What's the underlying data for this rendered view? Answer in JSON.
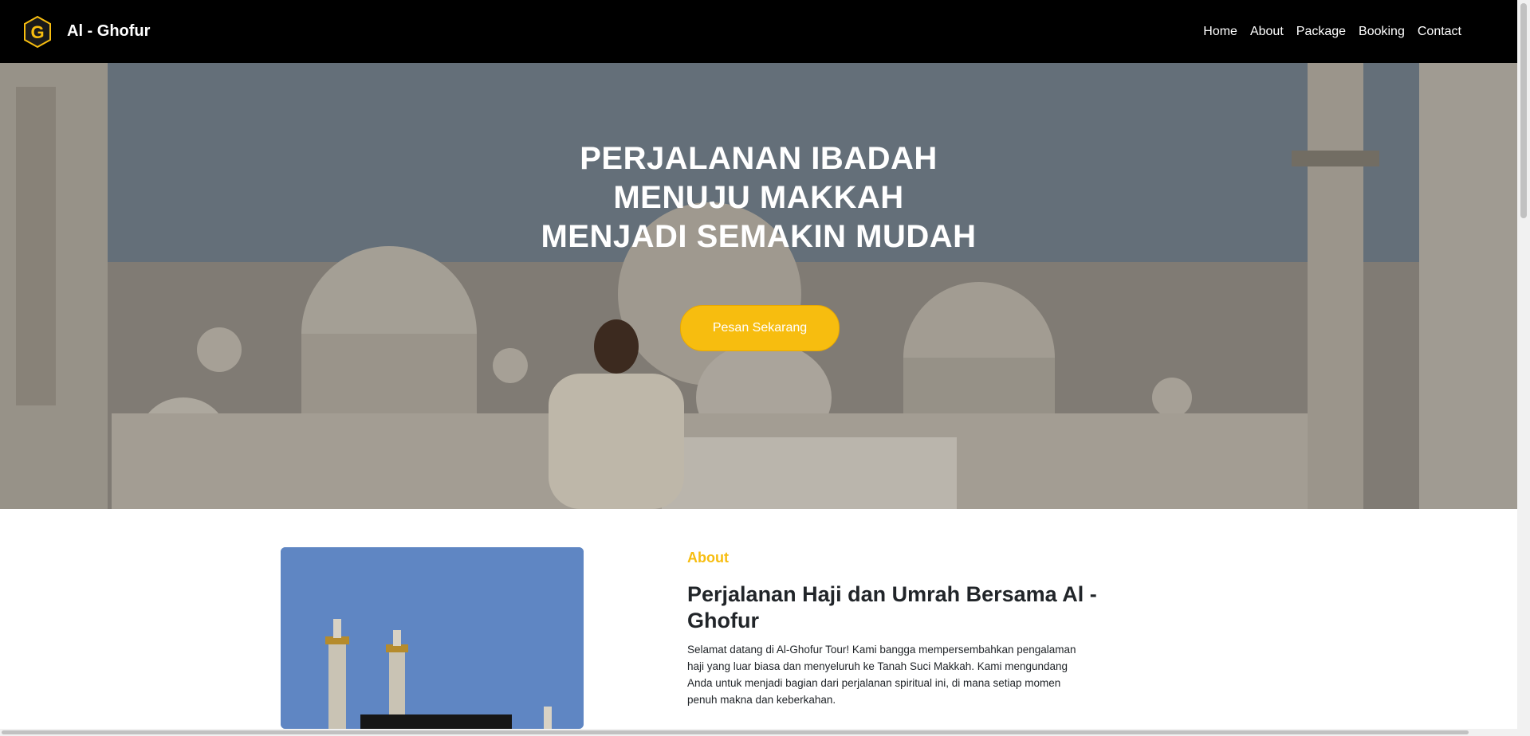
{
  "navbar": {
    "brand_name": "Al - Ghofur",
    "logo_letter": "G",
    "links": [
      "Home",
      "About",
      "Package",
      "Booking",
      "Contact"
    ]
  },
  "hero": {
    "title_lines": [
      "PERJALANAN IBADAH",
      "MENUJU MAKKAH",
      "MENJADI SEMAKIN MUDAH"
    ],
    "cta_label": "Pesan Sekarang"
  },
  "about": {
    "label": "About",
    "heading": "Perjalanan Haji dan Umrah Bersama Al - Ghofur",
    "text": "Selamat datang di Al-Ghofur Tour! Kami bangga mempersembahkan pengalaman haji yang luar biasa dan menyeluruh ke Tanah Suci Makkah. Kami mengundang Anda untuk menjadi bagian dari perjalanan spiritual ini, di mana setiap momen penuh makna dan keberkahan."
  },
  "colors": {
    "accent": "#f7bd0f",
    "navbar_bg": "#000000",
    "text": "#212529"
  },
  "icons": {
    "logo": "hexagon-g-logo-icon"
  }
}
